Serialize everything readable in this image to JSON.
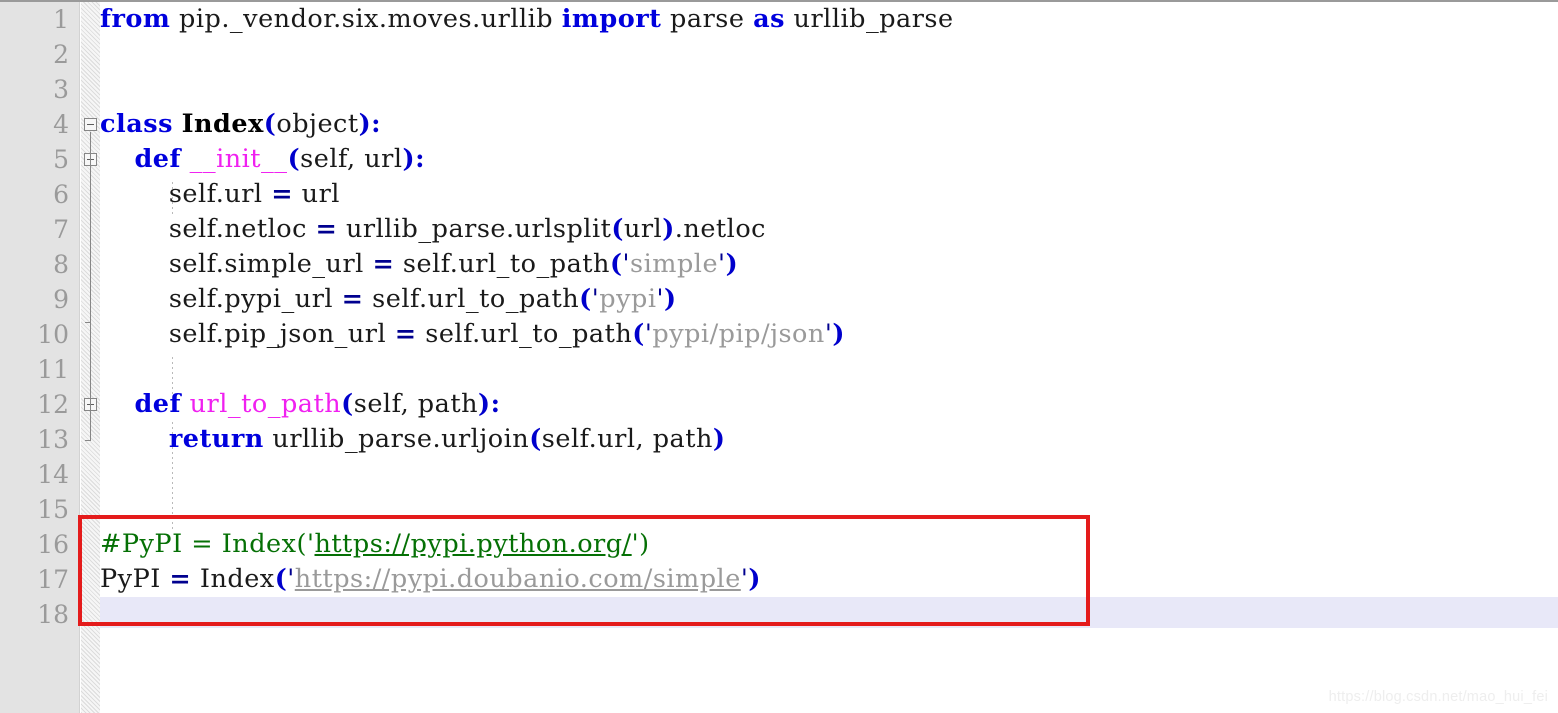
{
  "editor": {
    "language": "python",
    "gutter_bg": "#e3e3e3",
    "current_line_color": "#e8e8f8",
    "annotation_color": "#e41b1b",
    "line_height": 35,
    "first_line": 1,
    "last_line": 18,
    "current_line_number": 18
  },
  "line_numbers": [
    "1",
    "2",
    "3",
    "4",
    "5",
    "6",
    "7",
    "8",
    "9",
    "10",
    "11",
    "12",
    "13",
    "14",
    "15",
    "16",
    "17",
    "18"
  ],
  "lines": [
    {
      "n": 1,
      "text": "from pip._vendor.six.moves.urllib import parse as urllib_parse",
      "tokens": [
        {
          "t": "from",
          "c": "t-kw"
        },
        {
          "t": " pip._vendor.six.moves.urllib ",
          "c": "t-plain"
        },
        {
          "t": "import",
          "c": "t-kw"
        },
        {
          "t": " parse ",
          "c": "t-plain"
        },
        {
          "t": "as",
          "c": "t-kw"
        },
        {
          "t": " urllib_parse",
          "c": "t-plain"
        }
      ]
    },
    {
      "n": 2,
      "text": "",
      "tokens": []
    },
    {
      "n": 3,
      "text": "",
      "tokens": []
    },
    {
      "n": 4,
      "text": "class Index(object):",
      "tokens": [
        {
          "t": "class",
          "c": "t-kw"
        },
        {
          "t": " ",
          "c": "t-plain"
        },
        {
          "t": "Index",
          "c": "t-cls"
        },
        {
          "t": "(",
          "c": "t-punc"
        },
        {
          "t": "object",
          "c": "t-plain"
        },
        {
          "t": ")",
          "c": "t-punc"
        },
        {
          "t": ":",
          "c": "t-punc"
        }
      ]
    },
    {
      "n": 5,
      "text": "    def __init__(self, url):",
      "tokens": [
        {
          "t": "    ",
          "c": "t-plain"
        },
        {
          "t": "def",
          "c": "t-kw"
        },
        {
          "t": " ",
          "c": "t-plain"
        },
        {
          "t": "__init__",
          "c": "t-magenta"
        },
        {
          "t": "(",
          "c": "t-punc"
        },
        {
          "t": "self, url",
          "c": "t-plain"
        },
        {
          "t": ")",
          "c": "t-punc"
        },
        {
          "t": ":",
          "c": "t-punc"
        }
      ]
    },
    {
      "n": 6,
      "text": "        self.url = url",
      "tokens": [
        {
          "t": "        self.url ",
          "c": "t-plain"
        },
        {
          "t": "=",
          "c": "t-op"
        },
        {
          "t": " url",
          "c": "t-plain"
        }
      ]
    },
    {
      "n": 7,
      "text": "        self.netloc = urllib_parse.urlsplit(url).netloc",
      "tokens": [
        {
          "t": "        self.netloc ",
          "c": "t-plain"
        },
        {
          "t": "=",
          "c": "t-op"
        },
        {
          "t": " urllib_parse.urlsplit",
          "c": "t-plain"
        },
        {
          "t": "(",
          "c": "t-punc"
        },
        {
          "t": "url",
          "c": "t-plain"
        },
        {
          "t": ")",
          "c": "t-punc"
        },
        {
          "t": ".netloc",
          "c": "t-plain"
        }
      ]
    },
    {
      "n": 8,
      "text": "        self.simple_url = self.url_to_path('simple')",
      "tokens": [
        {
          "t": "        self.simple_url ",
          "c": "t-plain"
        },
        {
          "t": "=",
          "c": "t-op"
        },
        {
          "t": " self.url_to_path",
          "c": "t-plain"
        },
        {
          "t": "(",
          "c": "t-punc"
        },
        {
          "t": "'",
          "c": "t-quote"
        },
        {
          "t": "simple",
          "c": "t-str"
        },
        {
          "t": "'",
          "c": "t-quote"
        },
        {
          "t": ")",
          "c": "t-punc"
        }
      ]
    },
    {
      "n": 9,
      "text": "        self.pypi_url = self.url_to_path('pypi')",
      "tokens": [
        {
          "t": "        self.pypi_url ",
          "c": "t-plain"
        },
        {
          "t": "=",
          "c": "t-op"
        },
        {
          "t": " self.url_to_path",
          "c": "t-plain"
        },
        {
          "t": "(",
          "c": "t-punc"
        },
        {
          "t": "'",
          "c": "t-quote"
        },
        {
          "t": "pypi",
          "c": "t-str"
        },
        {
          "t": "'",
          "c": "t-quote"
        },
        {
          "t": ")",
          "c": "t-punc"
        }
      ]
    },
    {
      "n": 10,
      "text": "        self.pip_json_url = self.url_to_path('pypi/pip/json')",
      "tokens": [
        {
          "t": "        self.pip_json_url ",
          "c": "t-plain"
        },
        {
          "t": "=",
          "c": "t-op"
        },
        {
          "t": " self.url_to_path",
          "c": "t-plain"
        },
        {
          "t": "(",
          "c": "t-punc"
        },
        {
          "t": "'",
          "c": "t-quote"
        },
        {
          "t": "pypi/pip/json",
          "c": "t-str"
        },
        {
          "t": "'",
          "c": "t-quote"
        },
        {
          "t": ")",
          "c": "t-punc"
        }
      ]
    },
    {
      "n": 11,
      "text": "",
      "tokens": []
    },
    {
      "n": 12,
      "text": "    def url_to_path(self, path):",
      "tokens": [
        {
          "t": "    ",
          "c": "t-plain"
        },
        {
          "t": "def",
          "c": "t-kw"
        },
        {
          "t": " ",
          "c": "t-plain"
        },
        {
          "t": "url_to_path",
          "c": "t-magenta"
        },
        {
          "t": "(",
          "c": "t-punc"
        },
        {
          "t": "self, path",
          "c": "t-plain"
        },
        {
          "t": ")",
          "c": "t-punc"
        },
        {
          "t": ":",
          "c": "t-punc"
        }
      ]
    },
    {
      "n": 13,
      "text": "        return urllib_parse.urljoin(self.url, path)",
      "tokens": [
        {
          "t": "        ",
          "c": "t-plain"
        },
        {
          "t": "return",
          "c": "t-kw"
        },
        {
          "t": " urllib_parse.urljoin",
          "c": "t-plain"
        },
        {
          "t": "(",
          "c": "t-punc"
        },
        {
          "t": "self.url, path",
          "c": "t-plain"
        },
        {
          "t": ")",
          "c": "t-punc"
        }
      ]
    },
    {
      "n": 14,
      "text": "",
      "tokens": []
    },
    {
      "n": 15,
      "text": "",
      "tokens": []
    },
    {
      "n": 16,
      "text": "#PyPI = Index('https://pypi.python.org/')",
      "tokens": [
        {
          "t": "#PyPI = Index('",
          "c": "t-comment"
        },
        {
          "t": "https://pypi.python.org/",
          "c": "t-link-c"
        },
        {
          "t": "')",
          "c": "t-comment"
        }
      ]
    },
    {
      "n": 17,
      "text": "PyPI = Index('https://pypi.doubanio.com/simple')",
      "tokens": [
        {
          "t": "PyPI ",
          "c": "t-plain"
        },
        {
          "t": "=",
          "c": "t-op"
        },
        {
          "t": " Index",
          "c": "t-plain"
        },
        {
          "t": "(",
          "c": "t-punc"
        },
        {
          "t": "'",
          "c": "t-quote"
        },
        {
          "t": "https://pypi.doubanio.com/simple",
          "c": "t-link"
        },
        {
          "t": "'",
          "c": "t-quote"
        },
        {
          "t": ")",
          "c": "t-punc"
        }
      ]
    },
    {
      "n": 18,
      "text": "",
      "tokens": []
    }
  ],
  "fold_markers": [
    {
      "line": 4,
      "state": "expanded"
    },
    {
      "line": 5,
      "state": "expanded"
    },
    {
      "line": 12,
      "state": "expanded"
    }
  ],
  "watermark": "https://blog.csdn.net/mao_hui_fei"
}
